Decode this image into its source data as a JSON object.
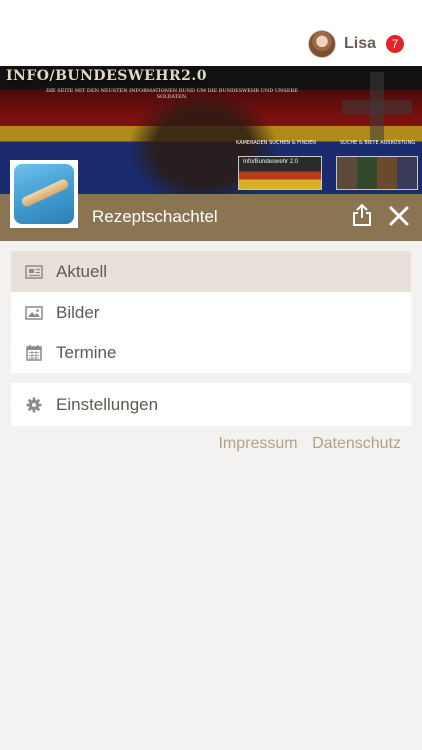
{
  "user": {
    "name": "Lisa",
    "notifications": "7"
  },
  "banner": {
    "title": "INFO/BUNDESWEHR2.0",
    "subtitle": "DIE SEITE MIT DEN NEUSTEN INFORMATIONEN RUND UM DIE BUNDESWEHR UND UNSERE SOLDATEN.",
    "link1": "KAMERADEN SUCHEN & FINDEN",
    "link2": "SUCHE & BIETE AUSRÜSTUNG",
    "thumb_title": "Info/Bundeswehr 2.0"
  },
  "group": {
    "name": "Rezeptschachtel"
  },
  "menu": {
    "items": [
      {
        "label": "Aktuell",
        "icon": "newspaper-icon",
        "active": true
      },
      {
        "label": "Bilder",
        "icon": "image-icon",
        "active": false
      },
      {
        "label": "Termine",
        "icon": "calendar-icon",
        "active": false
      }
    ],
    "settings": {
      "label": "Einstellungen",
      "icon": "gear-icon"
    }
  },
  "footer": {
    "impressum": "Impressum",
    "datenschutz": "Datenschutz"
  },
  "colors": {
    "brown_bar": "#8b7452",
    "badge": "#e42525",
    "active_item": "#e7e1da",
    "link": "#b3a089"
  }
}
